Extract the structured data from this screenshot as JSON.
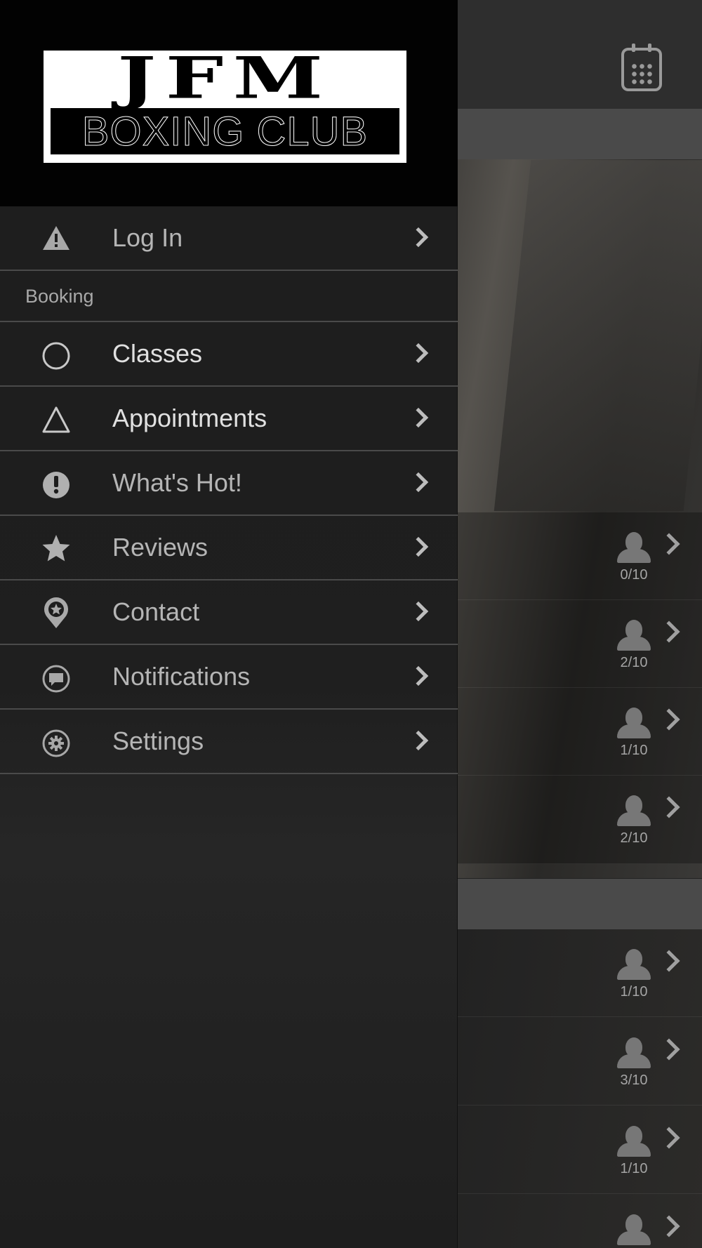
{
  "background_screen": {
    "calendar_icon": "calendar-icon",
    "rows_group_1": [
      {
        "count": "0/10"
      },
      {
        "count": "2/10"
      },
      {
        "count": "1/10"
      },
      {
        "count": "2/10"
      }
    ],
    "rows_group_2": [
      {
        "count": "1/10"
      },
      {
        "count": "3/10"
      },
      {
        "count": "1/10"
      },
      {
        "count": ""
      }
    ]
  },
  "logo": {
    "line1": "JFM",
    "line2": "BOXING CLUB"
  },
  "menu": {
    "login": {
      "label": "Log In",
      "icon": "warning-icon"
    },
    "section_booking": "Booking",
    "items": [
      {
        "label": "Classes",
        "icon": "circle-icon"
      },
      {
        "label": "Appointments",
        "icon": "triangle-icon"
      },
      {
        "label": "What's Hot!",
        "icon": "exclamation-icon"
      },
      {
        "label": "Reviews",
        "icon": "star-icon"
      },
      {
        "label": "Contact",
        "icon": "map-pin-icon"
      },
      {
        "label": "Notifications",
        "icon": "chat-bubble-icon"
      },
      {
        "label": "Settings",
        "icon": "gear-icon"
      }
    ]
  },
  "colors": {
    "menu_background": "#1e1e1e",
    "header_background": "#020202",
    "divider": "#4a4a4a",
    "text_primary": "#e0e0e0",
    "text_secondary": "#b5b5b5"
  }
}
